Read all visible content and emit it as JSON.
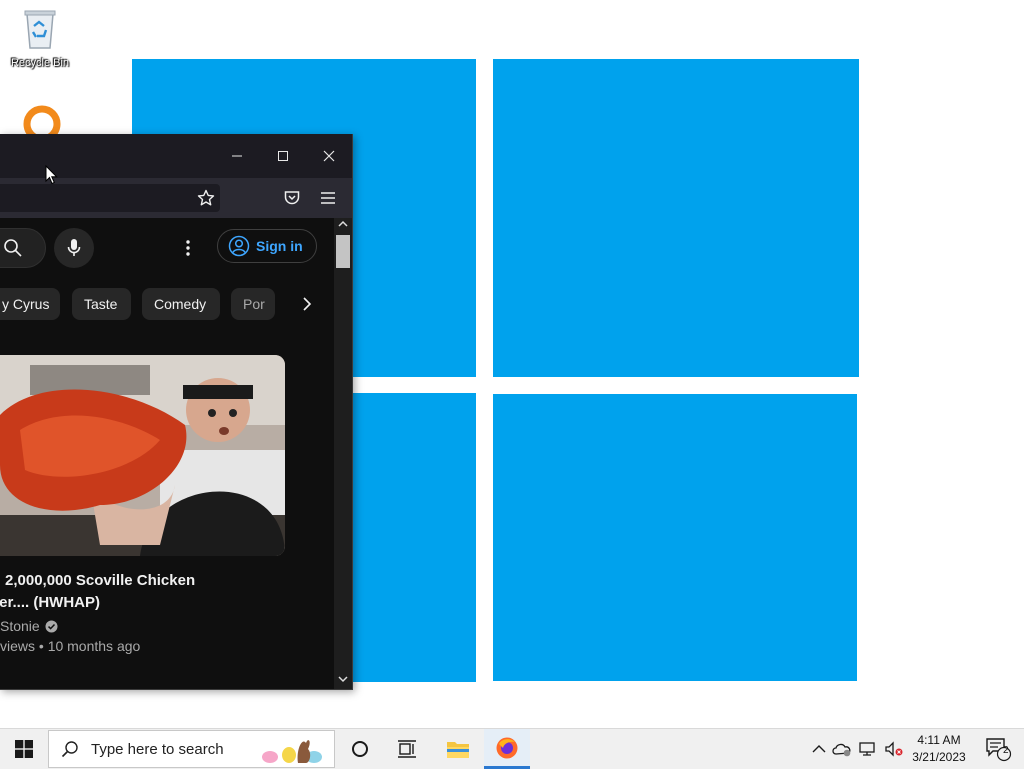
{
  "desktop": {
    "icons": [
      {
        "label": "Recycle Bin"
      }
    ]
  },
  "browser": {
    "signin_label": "Sign in",
    "chips": [
      "y Cyrus",
      "Taste",
      "Comedy",
      "Por"
    ],
    "video": {
      "title_line1": "2,000,000 Scoville Chicken",
      "title_line2": "der.... (HWHAP)",
      "channel": "Stonie",
      "meta": "views • 10 months ago"
    }
  },
  "taskbar": {
    "search_placeholder": "Type here to search",
    "clock_time": "4:11 AM",
    "clock_date": "3/21/2023",
    "notification_count": "2"
  },
  "colors": {
    "wallpaper": "#00a2ed",
    "youtube_bg": "#0f0f0f",
    "signin_blue": "#3ea6ff",
    "taskbar": "#f0f0f0"
  }
}
